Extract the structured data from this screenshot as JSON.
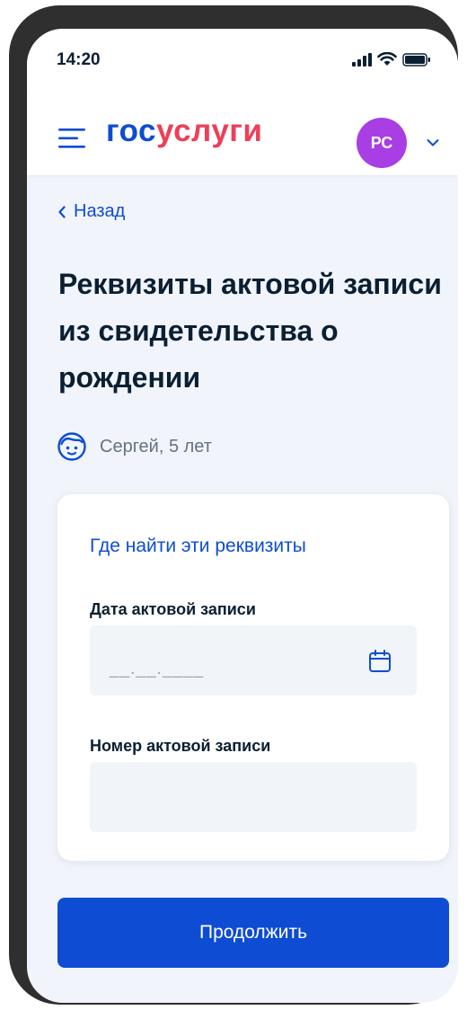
{
  "status_bar": {
    "time": "14:20"
  },
  "header": {
    "logo_part1": "гос",
    "logo_part2": "услуги",
    "avatar_initials": "РС"
  },
  "nav": {
    "back_label": "Назад"
  },
  "page": {
    "title": "Реквизиты актовой записи из свидетельства о рождении"
  },
  "child": {
    "name": "Сергей, 5 лет"
  },
  "form": {
    "help_link": "Где найти эти реквизиты",
    "date_label": "Дата актовой записи",
    "date_placeholder": "__.__.____",
    "number_label": "Номер актовой записи",
    "number_value": ""
  },
  "actions": {
    "continue_label": "Продолжить"
  },
  "colors": {
    "primary": "#0d4cd3",
    "logo_red": "#ee3f58",
    "avatar": "#a83ee4",
    "text": "#0b1f33",
    "background": "#f1f4fb"
  }
}
